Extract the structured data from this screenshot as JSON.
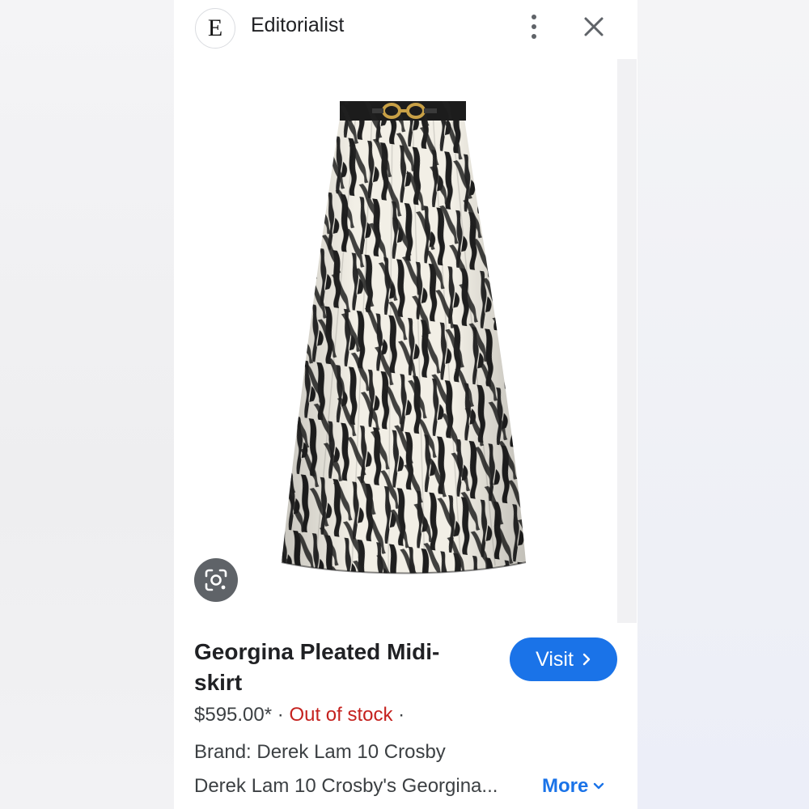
{
  "header": {
    "logo_letter": "E",
    "site_name": "Editorialist"
  },
  "product": {
    "image_icon": "zebra-print-pleated-midi-skirt-image",
    "title": "Georgina Pleated Midi-skirt",
    "price": "$595.00*",
    "separator": "·",
    "stock_status": "Out of stock",
    "brand": "Brand: Derek Lam 10 Crosby",
    "description": "Derek Lam 10 Crosby's Georgina...",
    "more_label": "More"
  },
  "actions": {
    "visit_label": "Visit"
  },
  "colors": {
    "accent": "#1a73e8",
    "out_of_stock": "#c5221f",
    "text": "#202124"
  }
}
